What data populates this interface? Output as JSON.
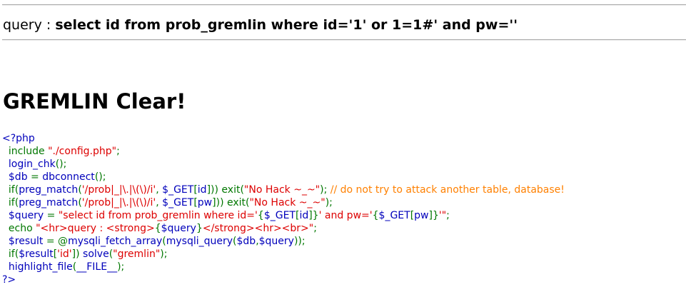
{
  "query_line": {
    "label": "query : ",
    "query": "select id from prob_gremlin where id='1' or 1=1#' and pw=''"
  },
  "result": {
    "title": "GREMLIN Clear!"
  },
  "source_code": {
    "lines": [
      [
        {
          "t": "<?php",
          "c": "default"
        }
      ],
      [
        {
          "t": "  include ",
          "c": "keyword"
        },
        {
          "t": "\"./config.php\"",
          "c": "string"
        },
        {
          "t": ";",
          "c": "keyword"
        }
      ],
      [
        {
          "t": "  login_chk",
          "c": "default"
        },
        {
          "t": "();",
          "c": "keyword"
        }
      ],
      [
        {
          "t": "  $db ",
          "c": "default"
        },
        {
          "t": "= ",
          "c": "keyword"
        },
        {
          "t": "dbconnect",
          "c": "default"
        },
        {
          "t": "();",
          "c": "keyword"
        }
      ],
      [
        {
          "t": "  if(",
          "c": "keyword"
        },
        {
          "t": "preg_match",
          "c": "default"
        },
        {
          "t": "(",
          "c": "keyword"
        },
        {
          "t": "'/prob|_|\\.|\\(\\)/i'",
          "c": "string"
        },
        {
          "t": ", ",
          "c": "keyword"
        },
        {
          "t": "$_GET",
          "c": "default"
        },
        {
          "t": "[",
          "c": "keyword"
        },
        {
          "t": "id",
          "c": "default"
        },
        {
          "t": "])) exit(",
          "c": "keyword"
        },
        {
          "t": "\"No Hack ~_~\"",
          "c": "string"
        },
        {
          "t": "); ",
          "c": "keyword"
        },
        {
          "t": "// do not try to attack another table, database!",
          "c": "comment"
        }
      ],
      [
        {
          "t": "  if(",
          "c": "keyword"
        },
        {
          "t": "preg_match",
          "c": "default"
        },
        {
          "t": "(",
          "c": "keyword"
        },
        {
          "t": "'/prob|_|\\.|\\(\\)/i'",
          "c": "string"
        },
        {
          "t": ", ",
          "c": "keyword"
        },
        {
          "t": "$_GET",
          "c": "default"
        },
        {
          "t": "[",
          "c": "keyword"
        },
        {
          "t": "pw",
          "c": "default"
        },
        {
          "t": "])) exit(",
          "c": "keyword"
        },
        {
          "t": "\"No Hack ~_~\"",
          "c": "string"
        },
        {
          "t": ");",
          "c": "keyword"
        }
      ],
      [
        {
          "t": "  $query ",
          "c": "default"
        },
        {
          "t": "= ",
          "c": "keyword"
        },
        {
          "t": "\"select id from prob_gremlin where id='",
          "c": "string"
        },
        {
          "t": "{",
          "c": "keyword"
        },
        {
          "t": "$_GET",
          "c": "default"
        },
        {
          "t": "[",
          "c": "keyword"
        },
        {
          "t": "id",
          "c": "default"
        },
        {
          "t": "]}",
          "c": "keyword"
        },
        {
          "t": "' and pw='",
          "c": "string"
        },
        {
          "t": "{",
          "c": "keyword"
        },
        {
          "t": "$_GET",
          "c": "default"
        },
        {
          "t": "[",
          "c": "keyword"
        },
        {
          "t": "pw",
          "c": "default"
        },
        {
          "t": "]}",
          "c": "keyword"
        },
        {
          "t": "'\"",
          "c": "string"
        },
        {
          "t": ";",
          "c": "keyword"
        }
      ],
      [
        {
          "t": "  echo ",
          "c": "keyword"
        },
        {
          "t": "\"<hr>query : <strong>",
          "c": "string"
        },
        {
          "t": "{",
          "c": "keyword"
        },
        {
          "t": "$query",
          "c": "default"
        },
        {
          "t": "}",
          "c": "keyword"
        },
        {
          "t": "</strong><hr><br>\"",
          "c": "string"
        },
        {
          "t": ";",
          "c": "keyword"
        }
      ],
      [
        {
          "t": "  $result ",
          "c": "default"
        },
        {
          "t": "= @",
          "c": "keyword"
        },
        {
          "t": "mysqli_fetch_array",
          "c": "default"
        },
        {
          "t": "(",
          "c": "keyword"
        },
        {
          "t": "mysqli_query",
          "c": "default"
        },
        {
          "t": "(",
          "c": "keyword"
        },
        {
          "t": "$db",
          "c": "default"
        },
        {
          "t": ",",
          "c": "keyword"
        },
        {
          "t": "$query",
          "c": "default"
        },
        {
          "t": "));",
          "c": "keyword"
        }
      ],
      [
        {
          "t": "  if(",
          "c": "keyword"
        },
        {
          "t": "$result",
          "c": "default"
        },
        {
          "t": "[",
          "c": "keyword"
        },
        {
          "t": "'id'",
          "c": "string"
        },
        {
          "t": "]) ",
          "c": "keyword"
        },
        {
          "t": "solve",
          "c": "default"
        },
        {
          "t": "(",
          "c": "keyword"
        },
        {
          "t": "\"gremlin\"",
          "c": "string"
        },
        {
          "t": ");",
          "c": "keyword"
        }
      ],
      [
        {
          "t": "  highlight_file",
          "c": "default"
        },
        {
          "t": "(",
          "c": "keyword"
        },
        {
          "t": "__FILE__",
          "c": "default"
        },
        {
          "t": ");",
          "c": "keyword"
        }
      ],
      [
        {
          "t": "?>",
          "c": "default"
        }
      ]
    ]
  }
}
